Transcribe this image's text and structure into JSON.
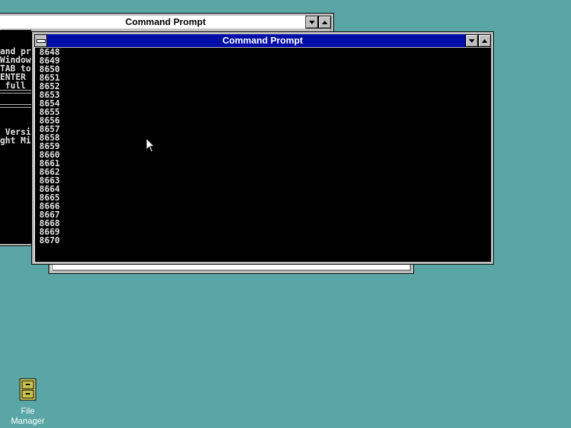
{
  "back_window": {
    "title": "Command Prompt",
    "console_lines_top": [
      "and pr",
      "Window",
      "TAB to",
      "ENTER",
      " full"
    ],
    "console_lines_bottom": [
      " Versi",
      "ght Mi"
    ]
  },
  "front_window": {
    "title": "Command Prompt",
    "console_lines": [
      "8648",
      "8649",
      "8650",
      "8651",
      "8652",
      "8653",
      "8654",
      "8655",
      "8656",
      "8657",
      "8658",
      "8659",
      "8660",
      "8661",
      "8662",
      "8663",
      "8664",
      "8665",
      "8666",
      "8667",
      "8668",
      "8669",
      "8670"
    ]
  },
  "desktop": {
    "background": "#5aa5a5",
    "icons": [
      {
        "label": "File Manager",
        "icon": "file-cabinet-icon"
      }
    ]
  },
  "colors": {
    "active_title": "#000ea8",
    "console_bg": "#000000",
    "console_text": "#e0e0e0"
  }
}
